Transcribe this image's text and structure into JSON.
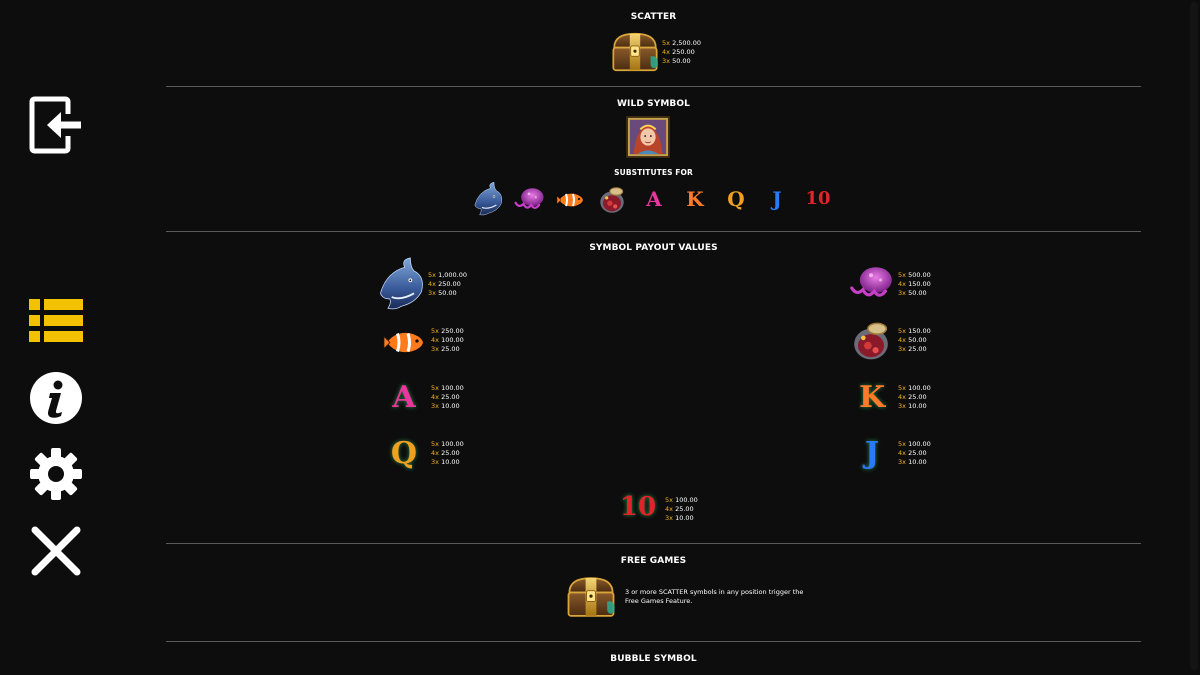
{
  "colors": {
    "background": "#0d0d0d",
    "multiplier": "#f2b418",
    "menu_icon": "#f2c200",
    "divider": "#5a5a5a"
  },
  "sidebar": {
    "buttons": [
      {
        "icon": "exit-icon"
      },
      {
        "icon": "paytable-menu-icon",
        "active": true
      },
      {
        "icon": "info-icon"
      },
      {
        "icon": "settings-gear-icon"
      },
      {
        "icon": "close-icon"
      }
    ]
  },
  "scatter": {
    "title": "SCATTER",
    "symbol": "treasure-chest",
    "payouts": [
      {
        "mult": "5x",
        "value": "2,500.00"
      },
      {
        "mult": "4x",
        "value": "250.00"
      },
      {
        "mult": "3x",
        "value": "50.00"
      }
    ]
  },
  "wild": {
    "title": "WILD SYMBOL",
    "symbol": "mermaid-queen",
    "substitutes_title": "SUBSTITUTES FOR",
    "substitutes": [
      "shark",
      "jellyfish",
      "clownfish",
      "treasure-pot",
      "A",
      "K",
      "Q",
      "J",
      "10"
    ]
  },
  "payout_values": {
    "title": "SYMBOL PAYOUT VALUES",
    "symbols": [
      {
        "symbol": "shark",
        "payouts": [
          {
            "mult": "5x",
            "value": "1,000.00"
          },
          {
            "mult": "4x",
            "value": "250.00"
          },
          {
            "mult": "3x",
            "value": "50.00"
          }
        ]
      },
      {
        "symbol": "jellyfish",
        "payouts": [
          {
            "mult": "5x",
            "value": "500.00"
          },
          {
            "mult": "4x",
            "value": "150.00"
          },
          {
            "mult": "3x",
            "value": "50.00"
          }
        ]
      },
      {
        "symbol": "clownfish",
        "payouts": [
          {
            "mult": "5x",
            "value": "250.00"
          },
          {
            "mult": "4x",
            "value": "100.00"
          },
          {
            "mult": "3x",
            "value": "25.00"
          }
        ]
      },
      {
        "symbol": "treasure-pot",
        "payouts": [
          {
            "mult": "5x",
            "value": "150.00"
          },
          {
            "mult": "4x",
            "value": "50.00"
          },
          {
            "mult": "3x",
            "value": "25.00"
          }
        ]
      },
      {
        "symbol": "A",
        "payouts": [
          {
            "mult": "5x",
            "value": "100.00"
          },
          {
            "mult": "4x",
            "value": "25.00"
          },
          {
            "mult": "3x",
            "value": "10.00"
          }
        ]
      },
      {
        "symbol": "K",
        "payouts": [
          {
            "mult": "5x",
            "value": "100.00"
          },
          {
            "mult": "4x",
            "value": "25.00"
          },
          {
            "mult": "3x",
            "value": "10.00"
          }
        ]
      },
      {
        "symbol": "Q",
        "payouts": [
          {
            "mult": "5x",
            "value": "100.00"
          },
          {
            "mult": "4x",
            "value": "25.00"
          },
          {
            "mult": "3x",
            "value": "10.00"
          }
        ]
      },
      {
        "symbol": "J",
        "payouts": [
          {
            "mult": "5x",
            "value": "100.00"
          },
          {
            "mult": "4x",
            "value": "25.00"
          },
          {
            "mult": "3x",
            "value": "10.00"
          }
        ]
      },
      {
        "symbol": "10",
        "payouts": [
          {
            "mult": "5x",
            "value": "100.00"
          },
          {
            "mult": "4x",
            "value": "25.00"
          },
          {
            "mult": "3x",
            "value": "10.00"
          }
        ]
      }
    ]
  },
  "free_games": {
    "title": "FREE GAMES",
    "symbol": "treasure-chest",
    "text_line1": "3 or more SCATTER symbols in any position trigger the",
    "text_line2": "Free Games Feature."
  },
  "bubble": {
    "title": "BUBBLE SYMBOL"
  }
}
